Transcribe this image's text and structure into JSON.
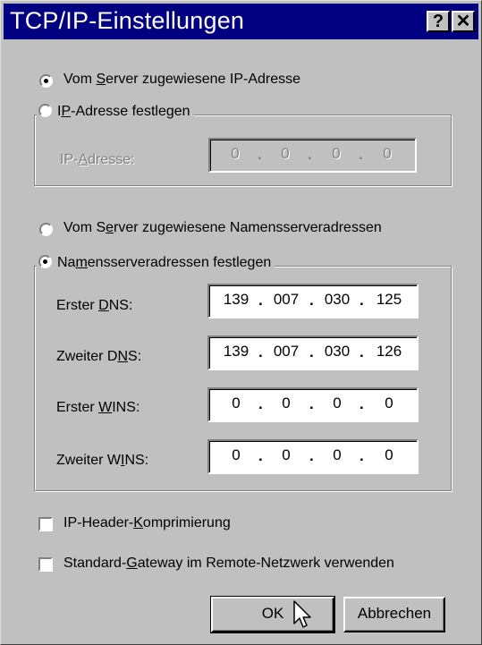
{
  "window": {
    "title": "TCP/IP-Einstellungen",
    "help_button": "?",
    "close_button": "✕"
  },
  "ip_section": {
    "radio_server": {
      "pre": "Vom ",
      "u": "S",
      "post": "erver zugewiesene IP-Adresse",
      "checked": true
    },
    "radio_fixed": {
      "pre": "I",
      "u": "P",
      "post": "-Adresse festlegen",
      "checked": false
    },
    "ip_label": {
      "pre": "IP-",
      "u": "A",
      "post": "dresse:"
    },
    "ip_value": [
      "0",
      "0",
      "0",
      "0"
    ]
  },
  "dns_section": {
    "radio_server": {
      "pre": "Vom S",
      "u": "e",
      "post": "rver zugewiesene Namensserveradressen",
      "checked": false
    },
    "radio_fixed": {
      "pre": "Na",
      "u": "m",
      "post": "ensserveradressen festlegen",
      "checked": true
    },
    "fields": [
      {
        "pre": "Erster ",
        "u": "D",
        "post": "NS:",
        "octets": [
          "139",
          "007",
          "030",
          "125"
        ]
      },
      {
        "pre": "Zweiter D",
        "u": "N",
        "post": "S:",
        "octets": [
          "139",
          "007",
          "030",
          "126"
        ]
      },
      {
        "pre": "Erster ",
        "u": "W",
        "post": "INS:",
        "octets": [
          "0",
          "0",
          "0",
          "0"
        ]
      },
      {
        "pre": "Zweiter W",
        "u": "I",
        "post": "NS:",
        "octets": [
          "0",
          "0",
          "0",
          "0"
        ]
      }
    ]
  },
  "options": {
    "header_compression": {
      "pre": "IP-Header-",
      "u": "K",
      "post": "omprimierung",
      "checked": false
    },
    "default_gateway": {
      "pre": "Standard-",
      "u": "G",
      "post": "ateway im Remote-Netzwerk verwenden",
      "checked": false
    }
  },
  "buttons": {
    "ok": "OK",
    "cancel": "Abbrechen"
  },
  "colors": {
    "titlebar": "#000080",
    "face": "#c0c0c0"
  }
}
